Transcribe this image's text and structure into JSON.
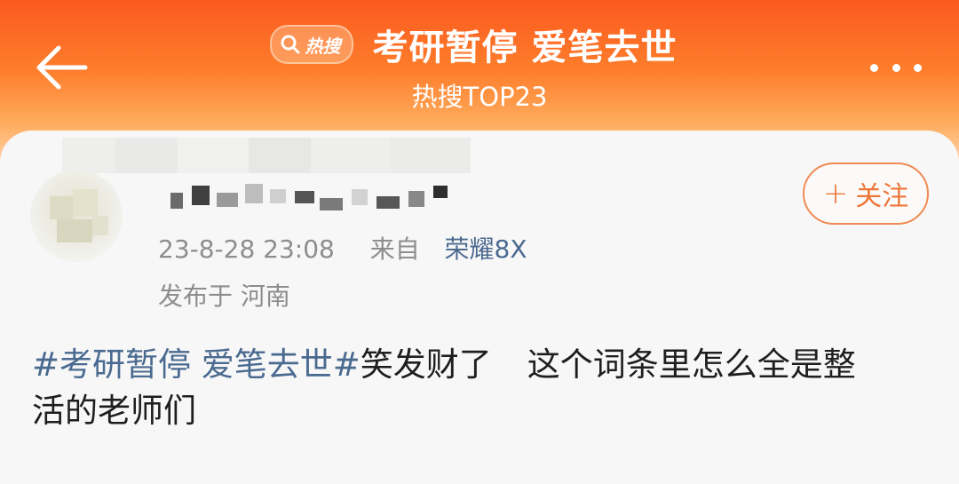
{
  "header": {
    "hot_badge_label": "热搜",
    "topic_title": "考研暂停 爱笔去世",
    "subtitle": "热搜TOP23"
  },
  "post": {
    "timestamp": "23-8-28 23:08",
    "source_prefix": "来自",
    "device": "荣耀8X",
    "location": "发布于 河南",
    "follow_label": "关注",
    "follow_icon": "plus-icon",
    "hashtag": "#考研暂停 爱笔去世#",
    "text_line1_after_hashtag": "笑发财了",
    "text_line1_tail": "这个词条里怎么全是整",
    "text_line2": "活的老师们"
  },
  "icons": {
    "back": "back-arrow-icon",
    "more": "more-icon",
    "search": "search-icon"
  },
  "colors": {
    "header_orange": "#fb5a1f",
    "link_blue": "#4a6a90",
    "follow_orange": "#ee7637",
    "meta_gray": "#8d8d8d"
  }
}
